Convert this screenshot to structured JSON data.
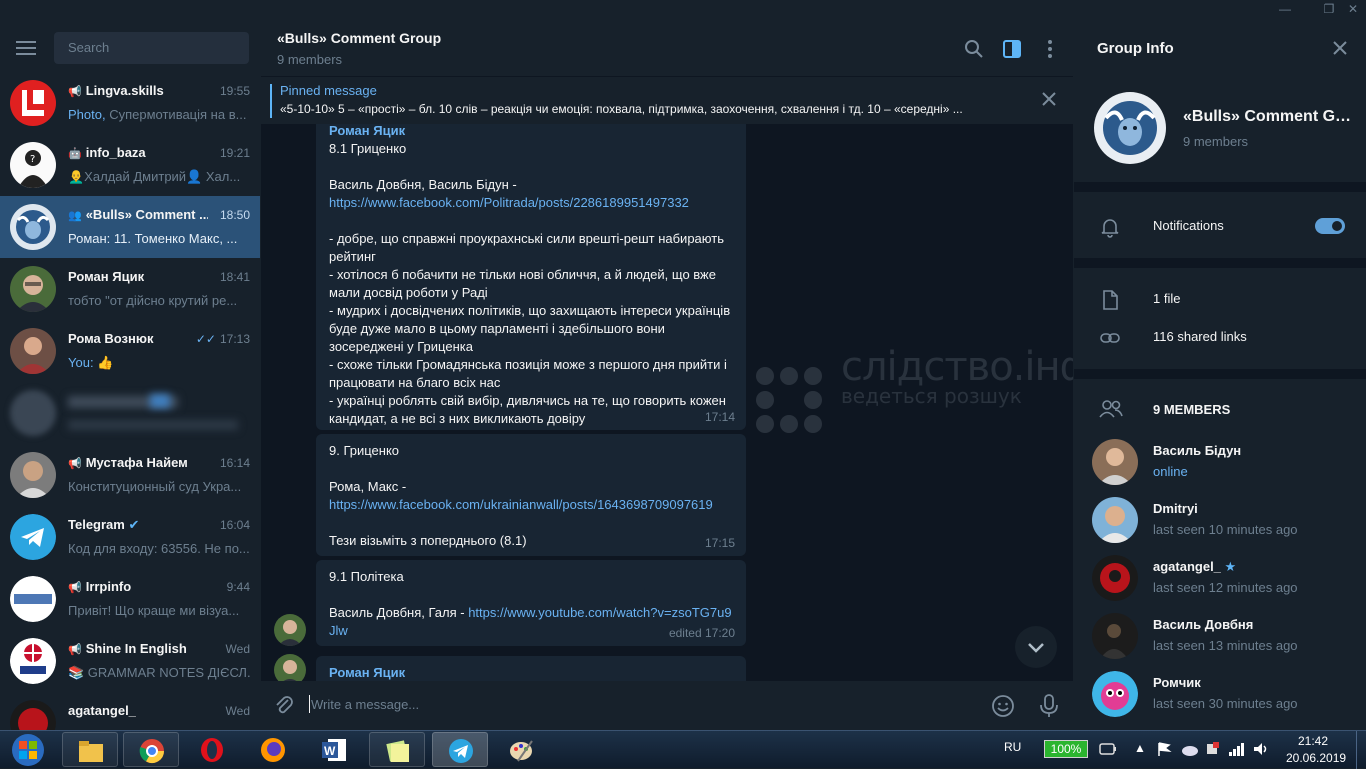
{
  "window": {
    "minimize": "—",
    "maximize": "❐",
    "close": "✕"
  },
  "sidebar": {
    "search_placeholder": "Search",
    "chats": [
      {
        "name": "Lingva.skills",
        "time": "19:55",
        "preview_accent": "Photo,",
        "preview": " Супермотивація на в...",
        "type": "channel"
      },
      {
        "name": "info_baza",
        "time": "19:21",
        "preview": "👨‍🦲Халдай Дмитрий👤 Хал...",
        "type": "bot"
      },
      {
        "name": "«Bulls» Comment ...",
        "time": "18:50",
        "preview": "Роман: 11. Томенко  Макс, ...",
        "type": "group",
        "active": true
      },
      {
        "name": "Роман Яцик",
        "time": "18:41",
        "preview": "тобто \"от дійсно крутий ре..."
      },
      {
        "name": "Рома Вознюк",
        "time": "17:13",
        "preview_accent": "You:",
        "preview": " 👍",
        "read": true
      },
      {
        "name": "",
        "time": "",
        "preview": "",
        "blurred": true
      },
      {
        "name": "Мустафа Найем",
        "time": "16:14",
        "preview": "Конституционный суд Укра...",
        "type": "channel"
      },
      {
        "name": "Telegram",
        "time": "16:04",
        "preview": "Код для входу: 63556. Не по...",
        "verified": true
      },
      {
        "name": "Irrpinfo",
        "time": "9:44",
        "preview": "Привіт!  Що краще ми візуа...",
        "type": "channel"
      },
      {
        "name": "Shine In English",
        "time": "Wed",
        "preview": "📚 GRAMMAR NOTES ДІЄСЛ...",
        "type": "channel"
      },
      {
        "name": "agatangel_",
        "time": "Wed",
        "preview": ""
      }
    ]
  },
  "chat": {
    "title": "«Bulls» Comment Group",
    "subtitle": "9 members",
    "pinned_title": "Pinned message",
    "pinned_text": "«5-10-10»  5 – «прості» – бл. 10 слів – реакція чи емоція: похвала, підтримка, заохочення, схвалення і тд. 10 – «середні» ...",
    "messages": [
      {
        "sender": "Роман Яцик",
        "lines": [
          "8.1 Гриценко",
          "",
          "Василь Довбня, Василь Бідун -"
        ],
        "link": "https://www.facebook.com/Politrada/posts/2286189951497332",
        "after": "\n- добре, що справжні проукрахнські сили врешті-решт набирають рейтинг\n- хотілося б побачити не тільки нові обличчя, а й людей, що вже мали досвід роботи у Раді\n- мудрих і досвідчених політиків, що захищають інтереси українців буде дуже мало в цьому парламенті і здебільшого вони зосереджені у Гриценка\n- схоже тільки Громадянська позиція може з першого дня прийти і працювати на благо всіх нас\n- українці роблять свій вибір, дивлячись на те, що говорить кожен кандидат, а не всі з них викликають довіру",
        "time": "17:14"
      },
      {
        "lines": [
          "9. Гриценко",
          "",
          "Рома, Макс -"
        ],
        "link": "https://www.facebook.com/ukrainianwall/posts/1643698709097619",
        "after": "\nТези візьміть з поперднього (8.1)",
        "time": "17:15"
      },
      {
        "lines": [
          "9.1 Політека",
          ""
        ],
        "inline_prefix": "Василь Довбня, Галя - ",
        "link": "https://www.youtube.com/watch?v=zsoTG7u9Jlw",
        "time": "edited 17:20"
      },
      {
        "sender": "Роман Яцик"
      }
    ],
    "composer_placeholder": "Write a message..."
  },
  "watermark": {
    "line1": "слідство.інфо",
    "line2": "ведеться розшук"
  },
  "info": {
    "title": "Group Info",
    "name": "«Bulls» Comment Group",
    "members_count": "9 members",
    "notifications_label": "Notifications",
    "notifications_on": true,
    "files": "1 file",
    "links": "116 shared links",
    "members_header": "9 MEMBERS",
    "members": [
      {
        "name": "Василь Бідун",
        "status": "online",
        "online": true
      },
      {
        "name": "Dmitryi",
        "status": "last seen 10 minutes ago"
      },
      {
        "name": "agatangel_",
        "status": "last seen 12 minutes ago",
        "star": "★"
      },
      {
        "name": "Василь Довбня",
        "status": "last seen 13 minutes ago"
      },
      {
        "name": "Ромчик",
        "status": "last seen 30 minutes ago"
      }
    ]
  },
  "taskbar": {
    "lang": "RU",
    "battery": "100%",
    "time": "21:42",
    "date": "20.06.2019"
  },
  "colors": {
    "accent": "#5eb5f7",
    "active_chat": "#2b5278",
    "bubble": "#182533",
    "bg": "#0e1621",
    "panel": "#17212b"
  }
}
